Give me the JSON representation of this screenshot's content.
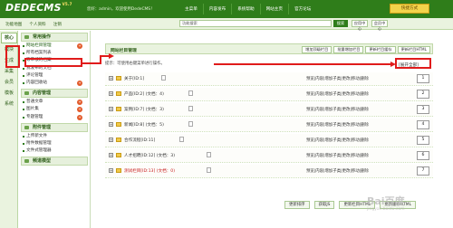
{
  "app": {
    "logo": "DEDECMS",
    "version": "V5.7",
    "user_info": "您好：admin，欢迎使用DedeCMS！",
    "top_nav": [
      "主菜单",
      "内容发布",
      "系统帮助",
      "网站主页",
      "官方论坛"
    ],
    "quick_action": "快捷方式"
  },
  "toolbar": {
    "links": [
      "功能地图",
      "个人资料",
      "注销"
    ],
    "search_placeholder": "功能搜索",
    "search_button": "搜索",
    "tabs": [
      "应用中心",
      "会员中心"
    ]
  },
  "vertical_tabs": [
    "核心",
    "模块",
    "生成",
    "采集",
    "会员",
    "模板",
    "系统"
  ],
  "sidebar": {
    "sections": [
      {
        "title": "常用操作",
        "items": [
          {
            "label": "网站栏目管理",
            "badge": "+"
          },
          {
            "label": "所有档案列表",
            "badge": ""
          },
          {
            "label": "等审核的档案",
            "badge": ""
          },
          {
            "label": "我发布的文档",
            "badge": ""
          },
          {
            "label": "评论管理",
            "badge": ""
          },
          {
            "label": "内容回收站",
            "badge": "+"
          }
        ]
      },
      {
        "title": "内容管理",
        "items": [
          {
            "label": "普通文章",
            "badge": "+"
          },
          {
            "label": "图片集",
            "badge": "+"
          },
          {
            "label": "专题管理",
            "badge": "+"
          }
        ]
      },
      {
        "title": "附件管理",
        "items": [
          {
            "label": "上传新文件",
            "badge": ""
          },
          {
            "label": "附件数据管理",
            "badge": ""
          },
          {
            "label": "文件式管理器",
            "badge": ""
          }
        ]
      },
      {
        "title": "频道模型",
        "items": []
      }
    ]
  },
  "panel": {
    "title": "网站栏目管理",
    "header_buttons": [
      "增加顶级栏目",
      "批量增加栏目",
      "更新栏目缓存",
      "更新栏目HTML"
    ],
    "tip": "提示：可使用右键菜单进行操作。",
    "expand_all": "[展开全部]"
  },
  "categories": [
    {
      "name": "关于[ID:1]",
      "count": "",
      "order": "1",
      "highlight": false
    },
    {
      "name": "产品[ID:2]",
      "count": "(文档：4)",
      "order": "2",
      "highlight": false
    },
    {
      "name": "案例[ID:7]",
      "count": "(文档：3)",
      "order": "3",
      "highlight": false
    },
    {
      "name": "新闻[ID:8]",
      "count": "(文档：5)",
      "order": "4",
      "highlight": false
    },
    {
      "name": "合作流程[ID:11]",
      "count": "",
      "order": "5",
      "highlight": false
    },
    {
      "name": "人才招聘[ID:12]",
      "count": "(文档：3)",
      "order": "6",
      "highlight": false
    },
    {
      "name": "测试栏目[ID:13]",
      "count": "(文档：0)",
      "order": "7",
      "highlight": true
    }
  ],
  "row_actions": "预览|内容|增加子类|更改|移动|删除",
  "bottom_buttons": [
    "更新排序",
    "获取JS",
    "更新栏目HTML",
    "更新缓存HTML"
  ],
  "watermark": {
    "main": "Bai百度",
    "sub": "jingyan.baidu.com"
  },
  "colors": {
    "header_green": "#2f7d1a",
    "annotation_red": "#e01b1b",
    "accent_yellow": "#f3d34b"
  }
}
